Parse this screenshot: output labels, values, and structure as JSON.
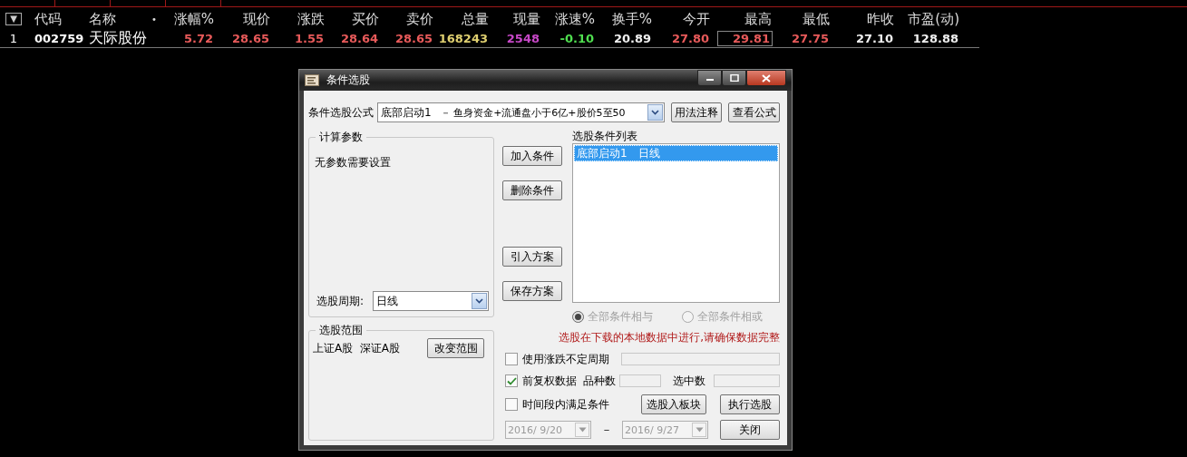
{
  "quote_table": {
    "sort_indicator": "▼",
    "columns": [
      "代码",
      "名称",
      "•",
      "涨幅%",
      "现价",
      "涨跌",
      "买价",
      "卖价",
      "总量",
      "现量",
      "涨速%",
      "换手%",
      "今开",
      "最高",
      "最低",
      "昨收",
      "市盈(动)"
    ],
    "rows": [
      {
        "index": "1",
        "cells": [
          {
            "text": "002759"
          },
          {
            "text": "天际股份"
          },
          {
            "text": ""
          },
          {
            "text": "5.72",
            "color": "#e85a5a",
            "highlighted": false
          },
          {
            "text": "28.65",
            "color": "#e85a5a",
            "highlighted": false
          },
          {
            "text": "1.55",
            "color": "#e85a5a",
            "highlighted": false
          },
          {
            "text": "28.64",
            "color": "#e85a5a",
            "highlighted": false
          },
          {
            "text": "28.65",
            "color": "#e85a5a",
            "highlighted": false
          },
          {
            "text": "168243",
            "color": "#e0d070",
            "highlighted": false
          },
          {
            "text": "2548",
            "color": "#c848c8",
            "highlighted": false
          },
          {
            "text": "-0.10",
            "color": "#50e050",
            "highlighted": false
          },
          {
            "text": "20.89",
            "color": "#f0f0f0",
            "highlighted": false
          },
          {
            "text": "27.80",
            "color": "#e85a5a",
            "highlighted": false
          },
          {
            "text": "29.81",
            "color": "#e85a5a",
            "highlighted": true
          },
          {
            "text": "27.75",
            "color": "#e85a5a",
            "highlighted": false
          },
          {
            "text": "27.10",
            "color": "#f0f0f0",
            "highlighted": false
          },
          {
            "text": "128.88",
            "color": "#f0f0f0",
            "highlighted": false
          }
        ]
      }
    ]
  },
  "dialog": {
    "title": "条件选股",
    "formula": {
      "label": "条件选股公式",
      "name": "底部启动1",
      "description": "－ 鱼身资金+流通盘小于6亿+股价5至50",
      "buttons": [
        "用法注释",
        "查看公式"
      ]
    },
    "params_group": {
      "title": "计算参数",
      "message": "无参数需要设置",
      "period_label": "选股周期:",
      "period_value": "日线"
    },
    "range_group": {
      "title": "选股范围",
      "markets": "上证A股  深证A股",
      "button": "改变范围"
    },
    "side_buttons": [
      "加入条件",
      "删除条件",
      "引入方案",
      "保存方案"
    ],
    "condition_list": {
      "label": "选股条件列表",
      "items": [
        {
          "name": "底部启动1",
          "period": "日线",
          "selected": true
        }
      ]
    },
    "logic_radios": [
      {
        "label": "全部条件相与",
        "selected": true,
        "disabled": true
      },
      {
        "label": "全部条件相或",
        "selected": false,
        "disabled": true
      }
    ],
    "notice": "选股在下载的本地数据中进行,请确保数据完整",
    "options": [
      {
        "label": "使用涨跌不定周期",
        "checked": false
      },
      {
        "label": "前复权数据",
        "checked": true
      },
      {
        "label": "时间段内满足条件",
        "checked": false
      }
    ],
    "count_labels": [
      "品种数",
      "选中数"
    ],
    "action_buttons": [
      "选股入板块",
      "执行选股"
    ],
    "date_range": {
      "start": "2016/ 9/20",
      "separator": "－",
      "end": "2016/ 9/27",
      "disabled": true
    },
    "close_button": "关闭"
  }
}
